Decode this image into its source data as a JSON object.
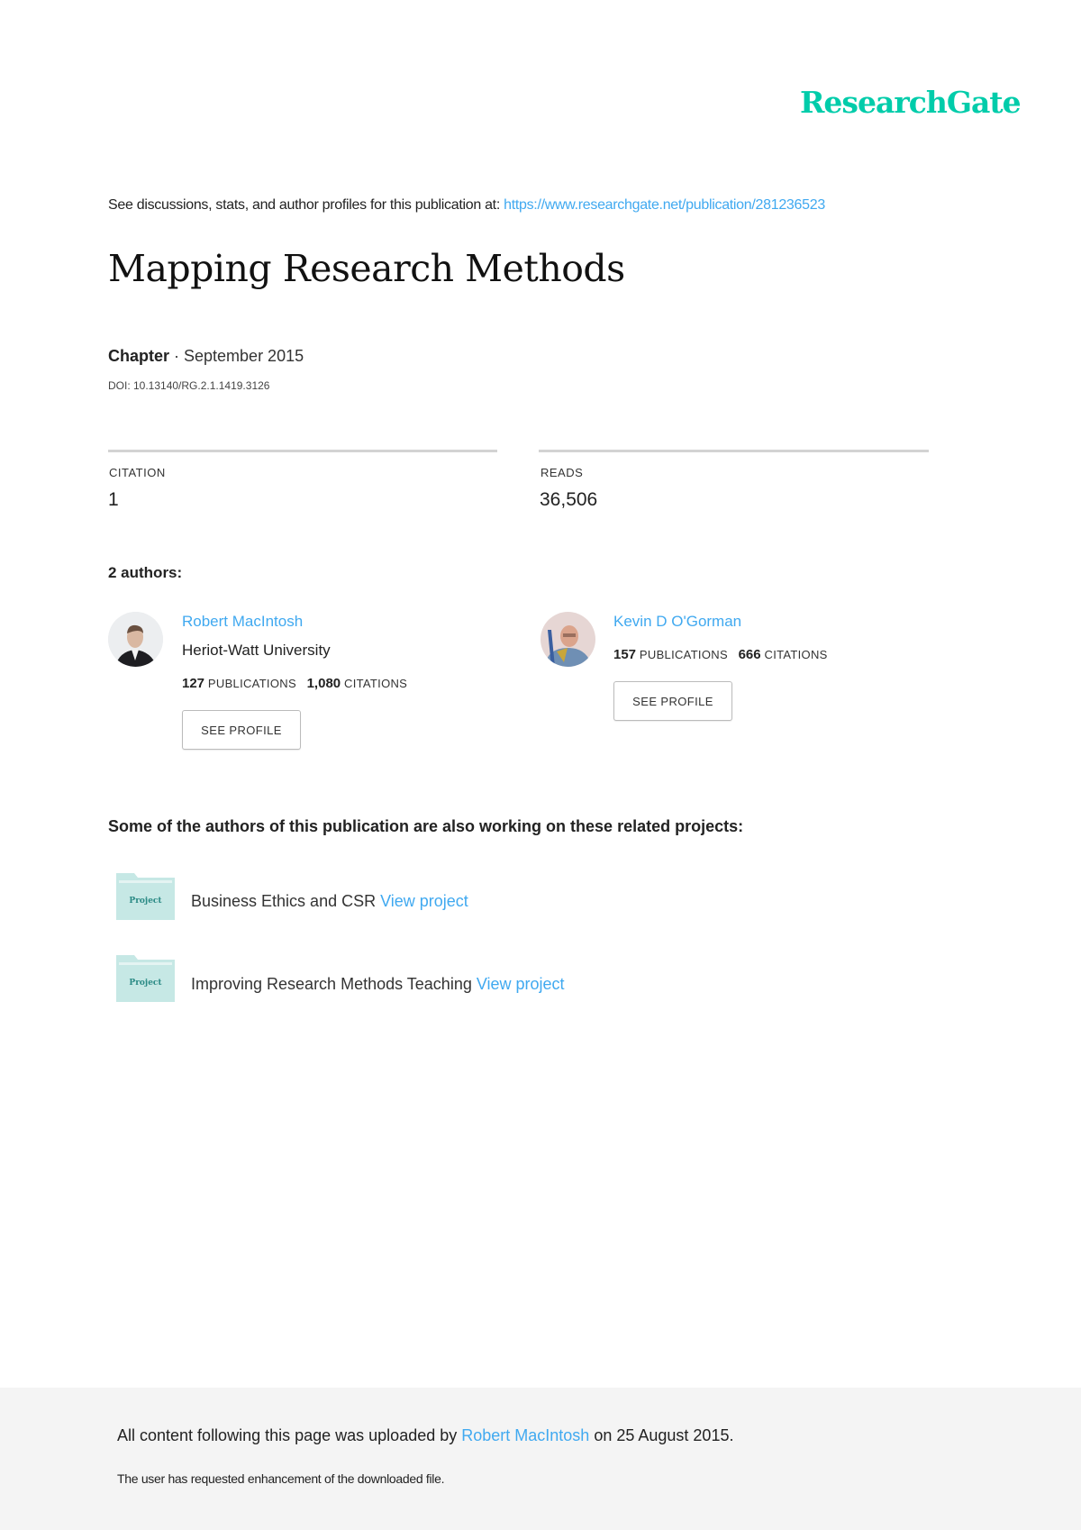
{
  "brand": {
    "logo": "ResearchGate",
    "color": "#00ccaa"
  },
  "header": {
    "intro": "See discussions, stats, and author profiles for this publication at: ",
    "url": "https://www.researchgate.net/publication/281236523"
  },
  "publication": {
    "title": "Mapping Research Methods",
    "type": "Chapter",
    "date": " · September 2015",
    "doi": "DOI: 10.13140/RG.2.1.1419.3126"
  },
  "stats": {
    "citation_label": "CITATION",
    "citation_value": "1",
    "reads_label": "READS",
    "reads_value": "36,506"
  },
  "authors_heading": "2 authors:",
  "authors": [
    {
      "name": "Robert MacIntosh",
      "affiliation": "Heriot-Watt University",
      "publications": "127",
      "publications_label": "PUBLICATIONS",
      "citations": "1,080",
      "citations_label": "CITATIONS",
      "button": "SEE PROFILE"
    },
    {
      "name": "Kevin D O'Gorman",
      "publications": "157",
      "publications_label": "PUBLICATIONS",
      "citations": "666",
      "citations_label": "CITATIONS",
      "button": "SEE PROFILE"
    }
  ],
  "projects_heading": "Some of the authors of this publication are also working on these related projects:",
  "projects": [
    {
      "icon_label": "Project",
      "title": "Business Ethics and CSR ",
      "link": "View project"
    },
    {
      "icon_label": "Project",
      "title": "Improving Research Methods Teaching ",
      "link": "View project"
    }
  ],
  "footer": {
    "uploaded_prefix": "All content following this page was uploaded by ",
    "uploader": "Robert MacIntosh",
    "uploaded_suffix": " on 25 August 2015.",
    "note": "The user has requested enhancement of the downloaded file."
  },
  "colors": {
    "link": "#40a9f0",
    "folder": "#c6e8e5",
    "footer_bg": "#f4f4f4"
  }
}
